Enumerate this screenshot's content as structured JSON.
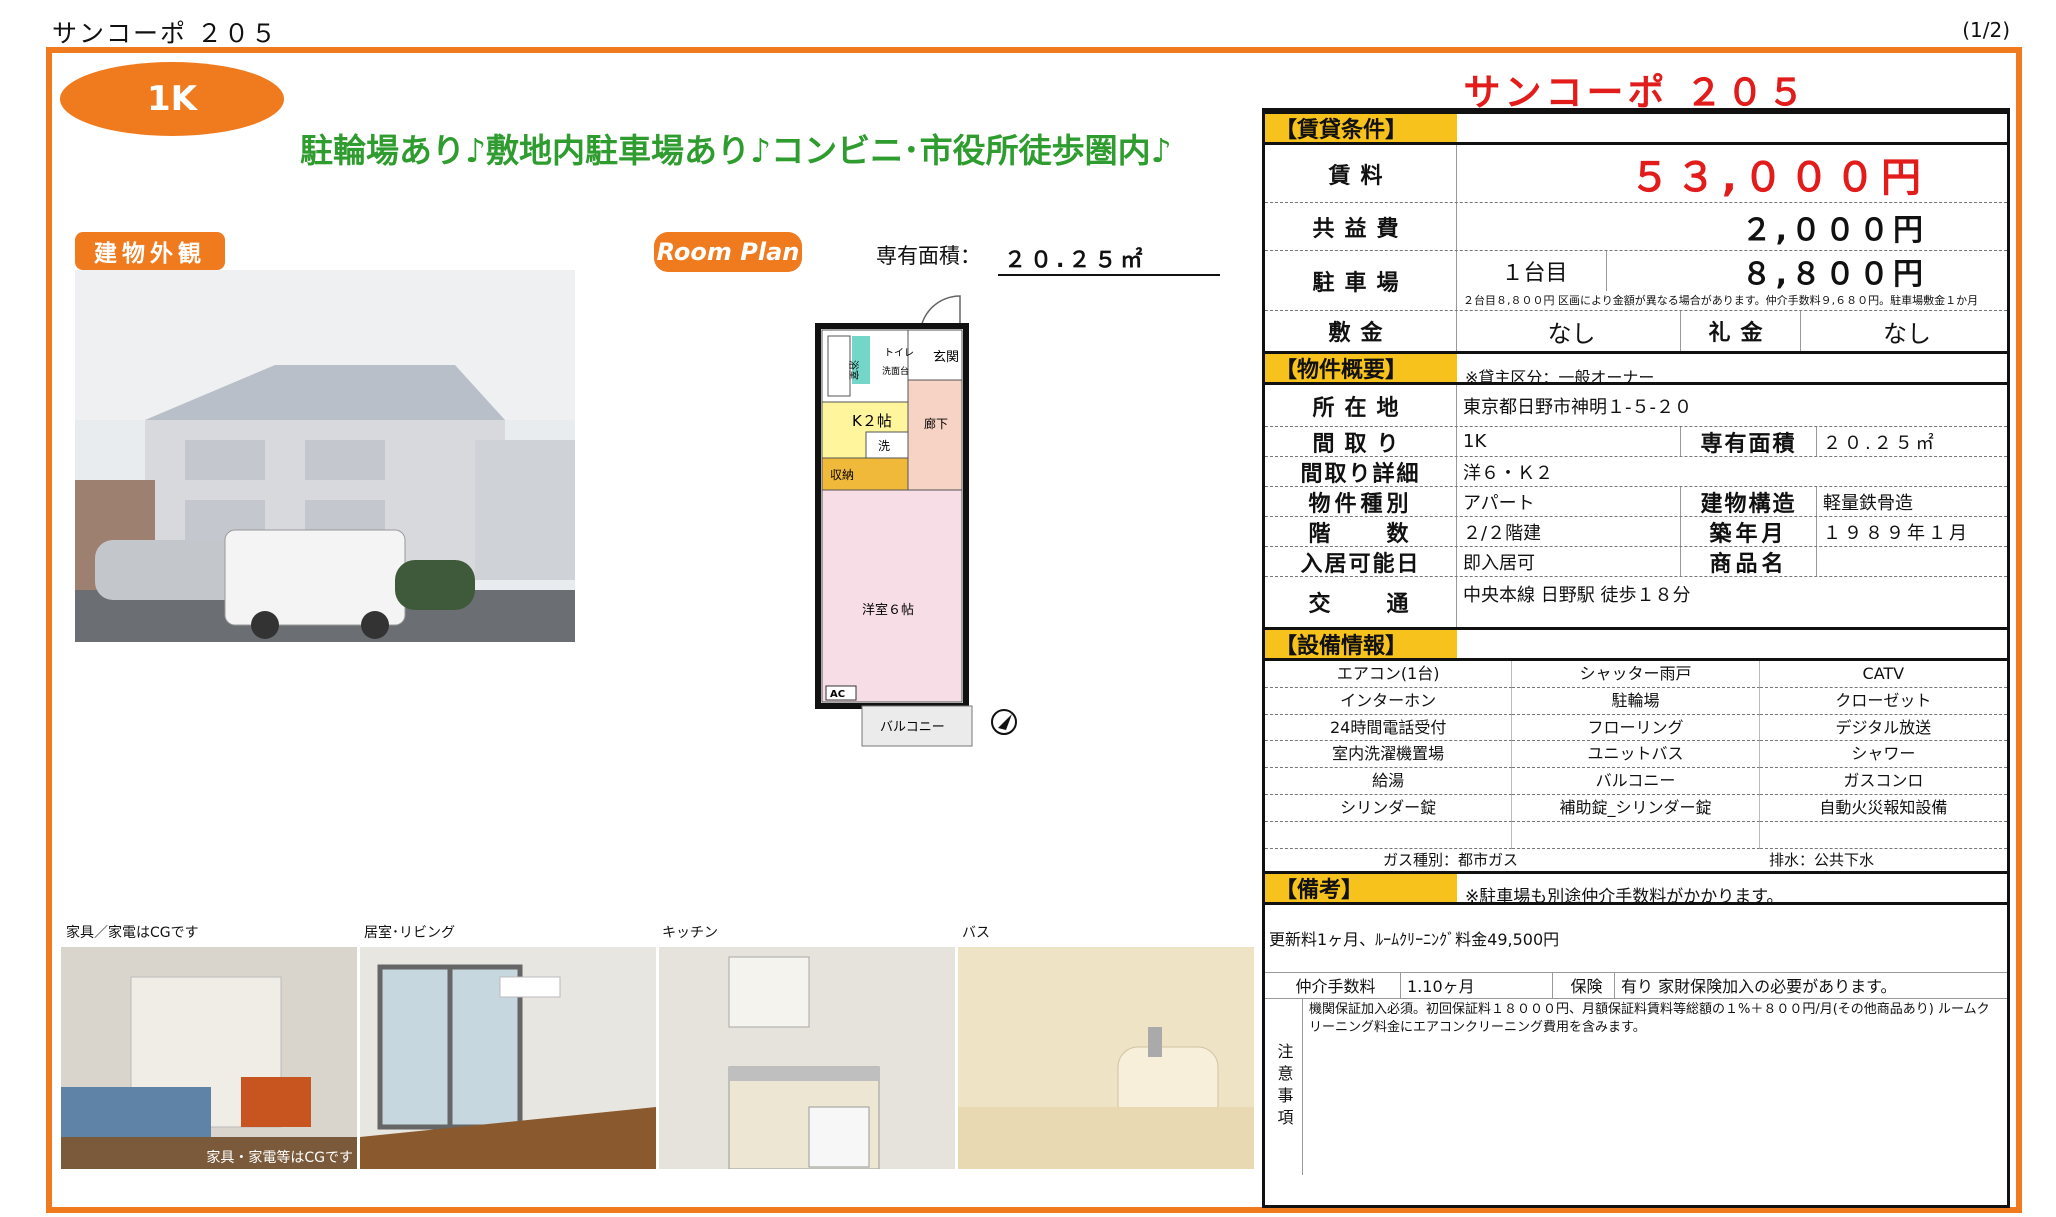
{
  "header": {
    "title": "サンコーポ ２０５",
    "page": "(1/2)"
  },
  "layout_type": "1K",
  "catchphrase": "駐輪場あり♪敷地内駐車場あり♪コンビニ･市役所徒歩圏内♪",
  "tags": {
    "exterior": "建物外観",
    "plan": "Room Plan"
  },
  "floor_plan": {
    "area_label": "専有面積：",
    "area_value": "２０.２５㎡",
    "rooms": {
      "entrance": "玄関",
      "bath": "浴室",
      "toilet": "トイレ",
      "sink": "洗面台",
      "kitchen": "K２帖",
      "wash": "洗",
      "closet": "収納",
      "hall": "廊下",
      "western": "洋室６帖",
      "ac": "AC",
      "balcony": "バルコニー"
    }
  },
  "photos": [
    {
      "caption": "家具／家電はCGです",
      "overlay": "家具・家電等はCGです"
    },
    {
      "caption": "居室･リビング"
    },
    {
      "caption": "キッチン"
    },
    {
      "caption": "バス"
    }
  ],
  "property_name": "サンコーポ ２０５",
  "rent_section": {
    "title": "【賃貸条件】",
    "rent_label": "賃料",
    "rent_value": "５３,０００円",
    "common_label": "共益費",
    "common_value": "２,０００円",
    "parking_label": "駐車場",
    "parking_unit": "１台目",
    "parking_value": "８,８００円",
    "parking_note": "２台目８,８００円 区画により金額が異なる場合があります。仲介手数料９,６８０円。駐車場敷金１か月",
    "deposit_label": "敷金",
    "deposit_value": "なし",
    "key_label": "礼金",
    "key_value": "なし"
  },
  "overview_section": {
    "title": "【物件概要】",
    "note": "※貸主区分：一般オーナー",
    "address_label": "所在地",
    "address_value": "東京都日野市神明１-５-２０",
    "madori_label": "間取り",
    "madori_value": "1K",
    "area_label": "専有面積",
    "area_value": "２０.２５㎡",
    "detail_label": "間取り詳細",
    "detail_value": "洋６・Ｋ２",
    "type_label": "物件種別",
    "type_value": "アパート",
    "structure_label": "建物構造",
    "structure_value": "軽量鉄骨造",
    "floor_label": "階　　数",
    "floor_value": "２/２階建",
    "built_label": "築年月",
    "built_value": "１９８９年１月",
    "movein_label": "入居可能日",
    "movein_value": "即入居可",
    "product_label": "商品名",
    "product_value": "",
    "transport_label": "交　　通",
    "transport_value": "中央本線 日野駅 徒歩１８分"
  },
  "equipment_section": {
    "title": "【設備情報】",
    "items": [
      "エアコン(1台)",
      "シャッター雨戸",
      "CATV",
      "インターホン",
      "駐輪場",
      "クローゼット",
      "24時間電話受付",
      "フローリング",
      "デジタル放送",
      "室内洗濯機置場",
      "ユニットバス",
      "シャワー",
      "給湯",
      "バルコニー",
      "ガスコンロ",
      "シリンダー錠",
      "補助錠_シリンダー錠",
      "自動火災報知設備",
      "",
      "",
      ""
    ],
    "gas": "ガス種別：都市ガス",
    "drain": "排水：公共下水"
  },
  "remarks_section": {
    "title": "【備考】",
    "note": "※駐車場も別途仲介手数料がかかります。",
    "renewal": "更新料1ヶ月、ﾙｰﾑｸﾘｰﾆﾝｸﾞ料金49,500円",
    "fee_label": "仲介手数料",
    "fee_value": "1.10ヶ月",
    "insurance_label": "保険",
    "insurance_value": "有り 家財保険加入の必要があります。",
    "caution_label": "注意事項",
    "caution_text": "機関保証加入必須。初回保証料１８０００円、月額保証料賃料等総額の１%＋８００円/月(その他商品あり) ルームクリーニング料金にエアコンクリーニング費用を含みます。"
  },
  "colors": {
    "accent": "#f07a1e",
    "green": "#2e9c2e",
    "red": "#e21b1b",
    "yellow": "#f8c21c"
  }
}
